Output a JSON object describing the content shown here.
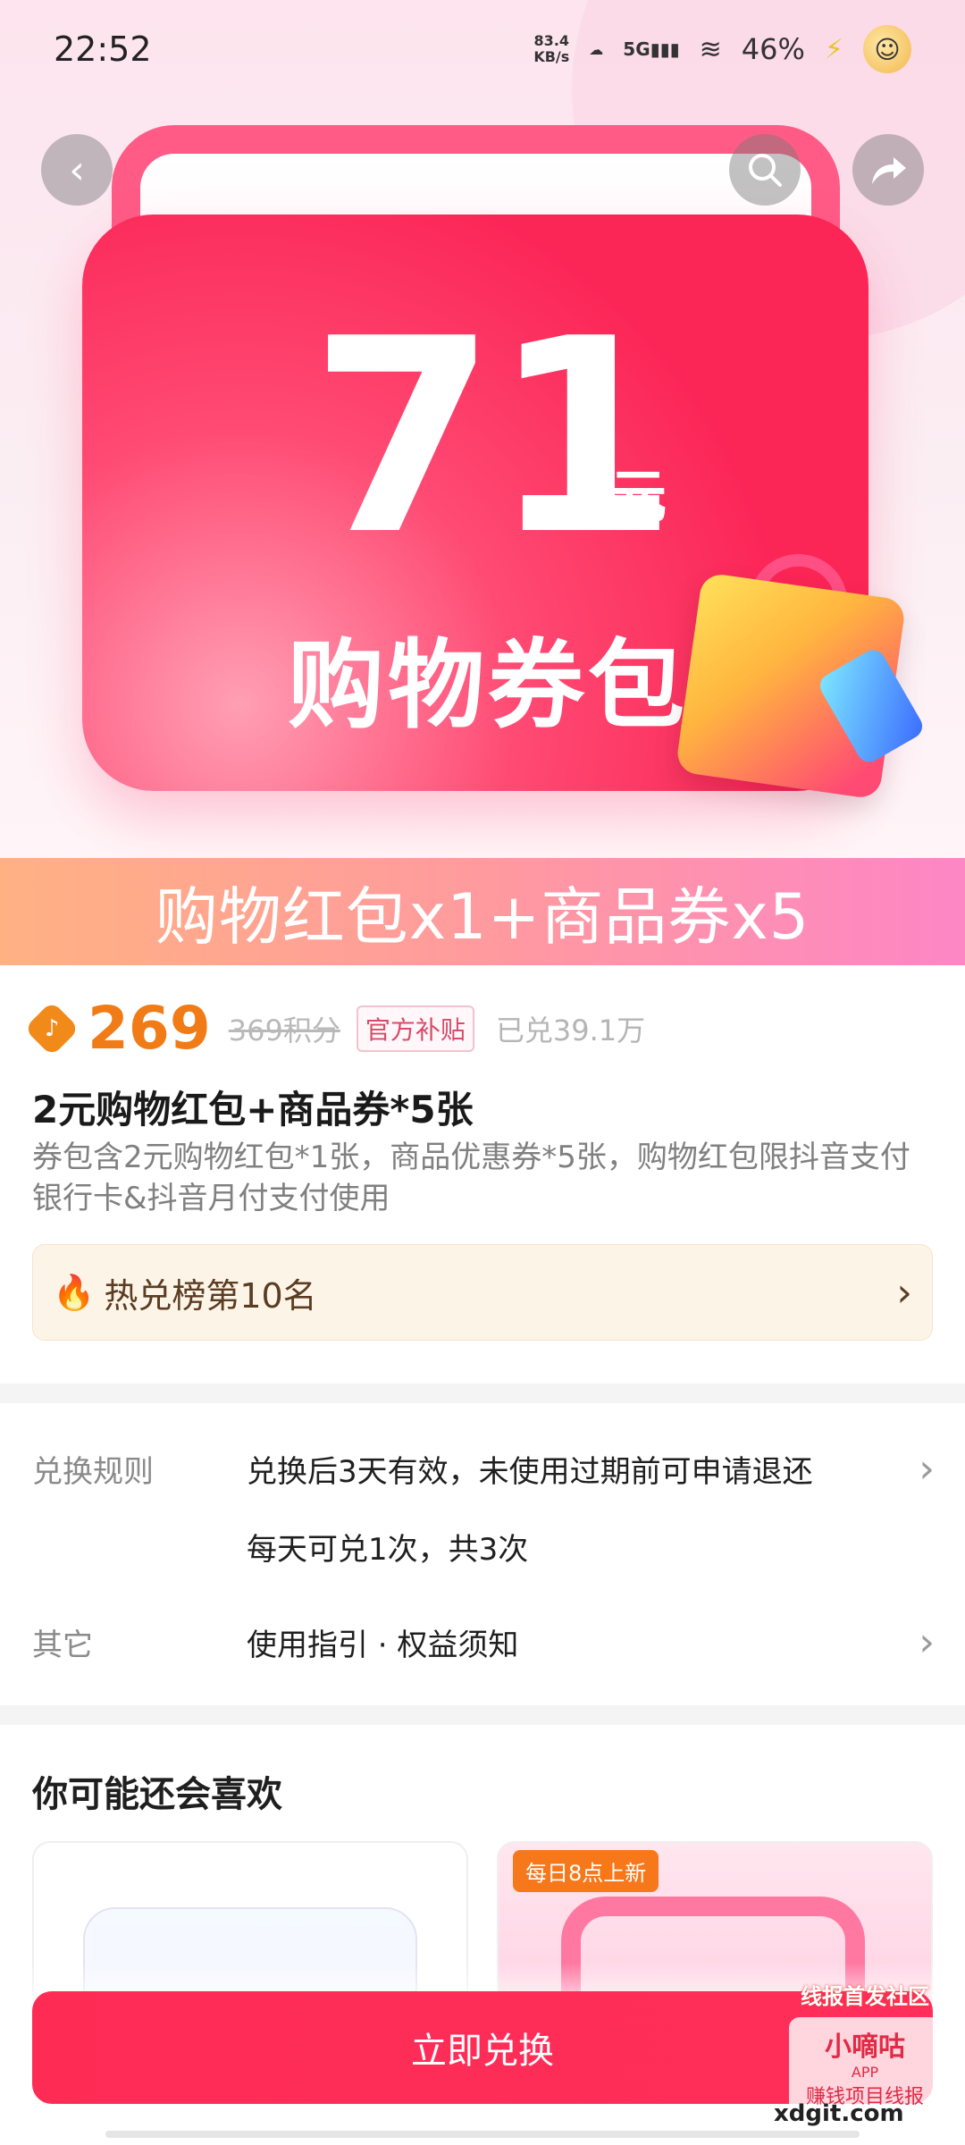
{
  "status_bar": {
    "time": "22:52",
    "net_speed": "83.4",
    "net_unit": "KB/s",
    "cloud_icon": "cloud-icon",
    "signal_label": "5G",
    "wifi_icon": "wifi-icon",
    "battery": "46%",
    "charging_icon": "bolt-icon"
  },
  "hero": {
    "amount": "71",
    "unit": "元",
    "title": "购物券包",
    "banner": "购物红包x1+商品券x5"
  },
  "nav": {
    "back_icon": "back-icon",
    "search_icon": "search-icon",
    "share_icon": "share-icon"
  },
  "product": {
    "price": "269",
    "original_price": "369积分",
    "official_tag": "官方补贴",
    "redeemed_count": "已兑39.1万",
    "title": "2元购物红包+商品券*5张",
    "description": "券包含2元购物红包*1张，商品优惠券*5张，购物红包限抖音支付银行卡&抖音月付支付使用"
  },
  "hot_rank": {
    "text": "热兑榜第10名"
  },
  "rules": [
    {
      "label": "兑换规则",
      "text": "兑换后3天有效，未使用过期前可申请退还",
      "sub": "每天可兑1次，共3次"
    },
    {
      "label": "其它",
      "text": "使用指引 · 权益须知"
    }
  ],
  "recommend": {
    "title": "你可能还会喜欢",
    "right_badge": "每日8点上新"
  },
  "action": {
    "redeem_label": "立即兑换"
  },
  "watermark": {
    "line1": "线报首发社区",
    "brand": "小嘀咕",
    "app": "APP",
    "slogan": "赚钱项目线报",
    "domain": "xdgit.com"
  },
  "colors": {
    "accent": "#fe2c55",
    "price": "#f07b17",
    "hotrank_bg": "#fdf4e8"
  }
}
